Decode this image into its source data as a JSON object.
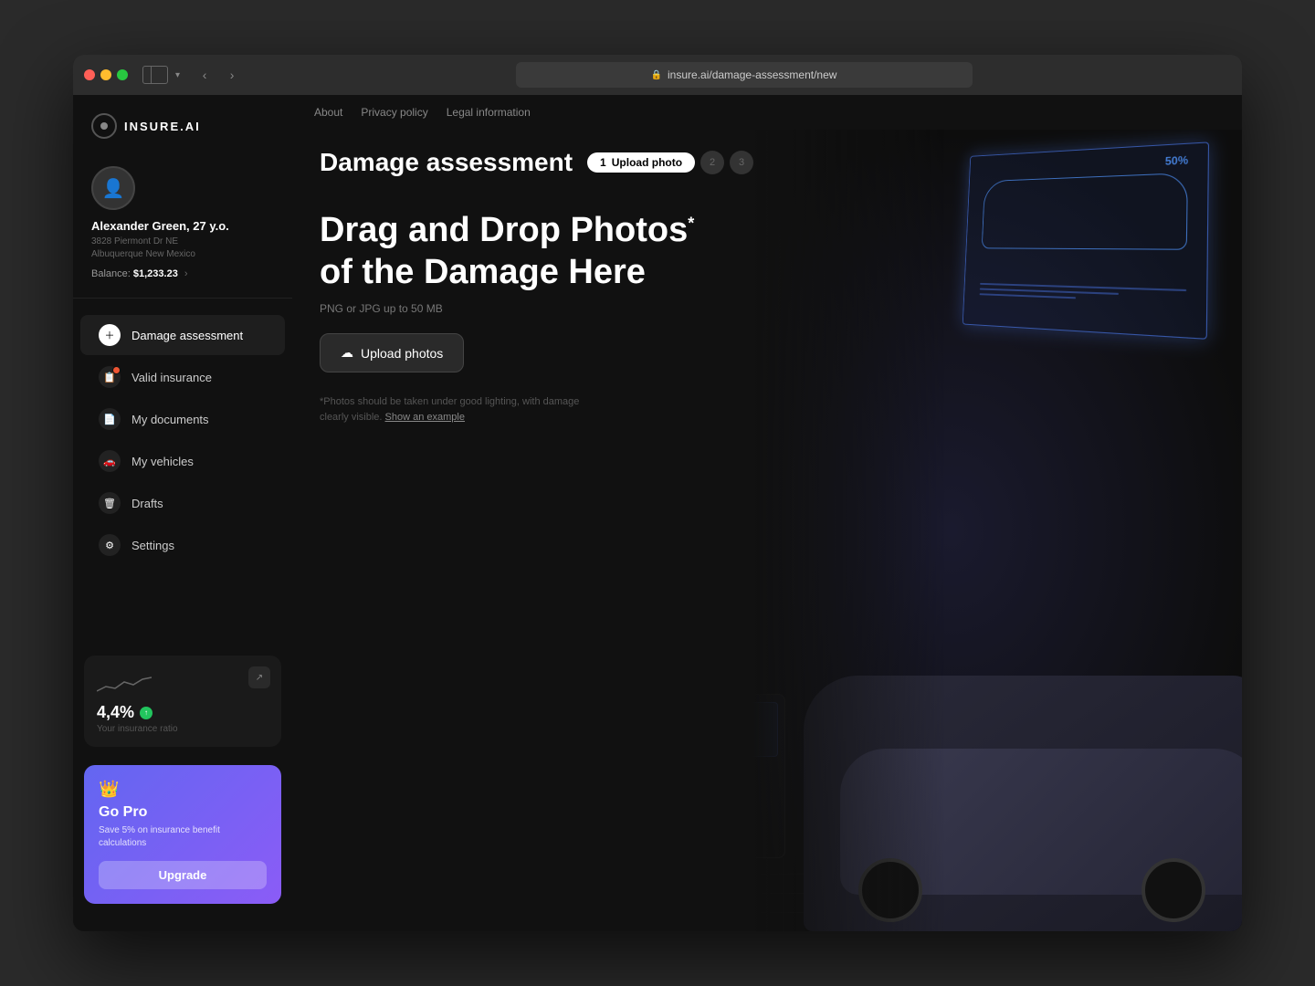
{
  "browser": {
    "url": "insure.ai/damage-assessment/new"
  },
  "logo": {
    "text": "INSURE.AI"
  },
  "user": {
    "name": "Alexander Green, 27 y.o.",
    "address_line1": "3828 Piermont Dr NE",
    "address_line2": "Albuquerque New Mexico",
    "balance_label": "Balance:",
    "balance_value": "$1,233.23"
  },
  "nav": {
    "items": [
      {
        "id": "damage-assessment",
        "label": "Damage assessment",
        "active": true
      },
      {
        "id": "valid-insurance",
        "label": "Valid insurance",
        "active": false
      },
      {
        "id": "my-documents",
        "label": "My documents",
        "active": false
      },
      {
        "id": "my-vehicles",
        "label": "My vehicles",
        "active": false
      },
      {
        "id": "drafts",
        "label": "Drafts",
        "active": false
      },
      {
        "id": "settings",
        "label": "Settings",
        "active": false
      }
    ]
  },
  "insurance_widget": {
    "ratio": "4,4%",
    "label": "Your insurance ratio"
  },
  "go_pro": {
    "title": "Go Pro",
    "description": "Save 5% on insurance benefit calculations",
    "button_label": "Upgrade"
  },
  "top_nav": {
    "links": [
      "About",
      "Privacy policy",
      "Legal information"
    ]
  },
  "page": {
    "title": "Damage assessment",
    "steps": [
      {
        "number": "1",
        "label": "Upload photo",
        "active": true
      },
      {
        "number": "2",
        "label": "",
        "active": false
      },
      {
        "number": "3",
        "label": "",
        "active": false
      }
    ]
  },
  "upload": {
    "heading_line1": "Drag and Drop Photos",
    "heading_asterisk": "*",
    "heading_line2": "of the Damage Here",
    "file_types": "PNG or JPG up to 50 MB",
    "button_label": "Upload photos",
    "hint_text": "*Photos should be taken under good lighting, with damage clearly visible.",
    "show_example": "Show an example"
  }
}
